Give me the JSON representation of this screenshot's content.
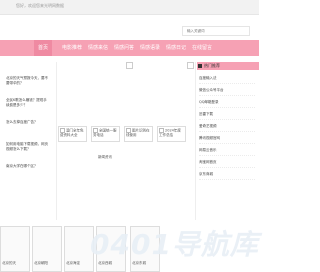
{
  "topbar": {
    "welcome": "您好，欢迎您来光明网数据"
  },
  "search": {
    "placeholder": "输入关键词"
  },
  "nav": {
    "items": [
      "首页",
      "电影推荐",
      "情感来信",
      "情感问答",
      "情感语录",
      "情感日记",
      "在线留言"
    ]
  },
  "left_list": [
    "北京的天气预报今天，要不要带伞的？",
    "全民K歌怎么赚钱？提现手续费是多少？",
    "怎么去掉百度广告？",
    "如何用电脑下载视频，网页视频怎么下载？",
    "南京大学在哪个区？"
  ],
  "cards": [
    {
      "label": "澳门全年免费资料大全"
    },
    {
      "label": "全国统一服务电话"
    },
    {
      "label": "图片识别在线使用"
    },
    {
      "label": "2024年度工作总结"
    }
  ],
  "sub_card": {
    "label": "新闻资讯"
  },
  "sidebar": {
    "title": "热门推荐",
    "items": [
      "百度输入法",
      "微信公众号平台",
      "QQ邮箱登录",
      "迅雷下载",
      "爱奇艺视频",
      "腾讯视频官网",
      "网易云音乐",
      "淘宝网首页",
      "京东商城"
    ]
  },
  "footer_cards": [
    {
      "label": "北京的天"
    },
    {
      "label": "北京朝阳"
    },
    {
      "label": "北京海淀"
    },
    {
      "label": "北京西城"
    },
    {
      "label": "北京东城"
    }
  ],
  "watermark": {
    "text": "0401导航库"
  }
}
